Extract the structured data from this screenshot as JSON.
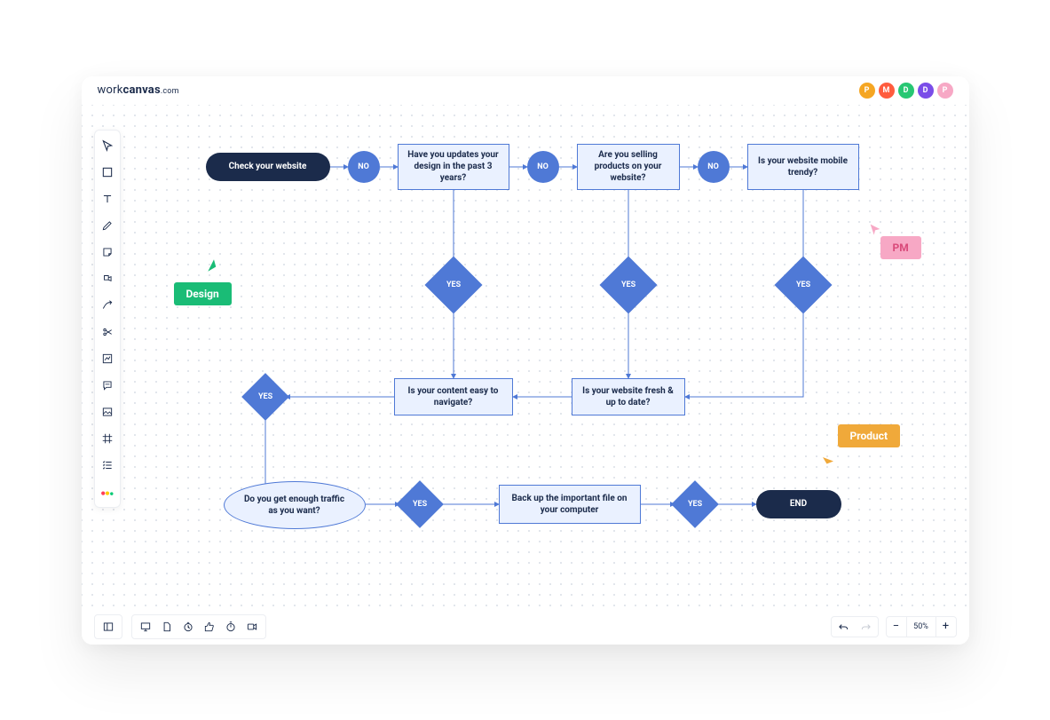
{
  "logo": {
    "part1": "work",
    "part2": "canvas",
    "tld": ".com"
  },
  "avatars": [
    {
      "initial": "P",
      "color": "#f5a623"
    },
    {
      "initial": "M",
      "color": "#ff5c3e"
    },
    {
      "initial": "D",
      "color": "#27c773"
    },
    {
      "initial": "D",
      "color": "#7a4de8"
    },
    {
      "initial": "P",
      "color": "#f7a8c5"
    }
  ],
  "zoom": {
    "level": "50%"
  },
  "nodes": {
    "start": "Check your website",
    "q1": "Have you updates your design in the past 3 years?",
    "q2": "Are you selling products on your website?",
    "q3": "Is your website mobile trendy?",
    "q4": "Is your content easy to navigate?",
    "q5": "Is your website fresh & up to date?",
    "q6": "Do you get enough traffic as you want?",
    "backup": "Back up the important file on your computer",
    "end": "END"
  },
  "labels": {
    "no": "NO",
    "yes": "YES"
  },
  "user_tags": {
    "design": {
      "text": "Design",
      "color": "#1abc76"
    },
    "pm": {
      "text": "PM",
      "color": "#f7a8c5"
    },
    "product": {
      "text": "Product",
      "color": "#f0a93a"
    }
  },
  "chart_data": {
    "type": "flowchart",
    "title": "Website audit decision flow",
    "nodes": [
      {
        "id": "start",
        "type": "terminator",
        "text": "Check your website"
      },
      {
        "id": "no1",
        "type": "connector-circle",
        "text": "NO"
      },
      {
        "id": "q1",
        "type": "process",
        "text": "Have you updates your design in the past 3 years?"
      },
      {
        "id": "no2",
        "type": "connector-circle",
        "text": "NO"
      },
      {
        "id": "q2",
        "type": "process",
        "text": "Are you selling products on your website?"
      },
      {
        "id": "no3",
        "type": "connector-circle",
        "text": "NO"
      },
      {
        "id": "q3",
        "type": "process",
        "text": "Is your website mobile trendy?"
      },
      {
        "id": "yes1",
        "type": "decision",
        "text": "YES"
      },
      {
        "id": "yes2",
        "type": "decision",
        "text": "YES"
      },
      {
        "id": "yes3",
        "type": "decision",
        "text": "YES"
      },
      {
        "id": "q4",
        "type": "process",
        "text": "Is your content easy to navigate?"
      },
      {
        "id": "q5",
        "type": "process",
        "text": "Is your website fresh & up to date?"
      },
      {
        "id": "yes4",
        "type": "decision",
        "text": "YES"
      },
      {
        "id": "q6",
        "type": "ellipse",
        "text": "Do you get enough traffic as you want?"
      },
      {
        "id": "yes5",
        "type": "decision",
        "text": "YES"
      },
      {
        "id": "backup",
        "type": "process",
        "text": "Back up the important file on your computer"
      },
      {
        "id": "yes6",
        "type": "decision",
        "text": "YES"
      },
      {
        "id": "end",
        "type": "terminator",
        "text": "END"
      }
    ],
    "edges": [
      {
        "from": "start",
        "to": "no1"
      },
      {
        "from": "no1",
        "to": "q1"
      },
      {
        "from": "q1",
        "to": "no2"
      },
      {
        "from": "no2",
        "to": "q2"
      },
      {
        "from": "q2",
        "to": "no3"
      },
      {
        "from": "no3",
        "to": "q3"
      },
      {
        "from": "q1",
        "to": "yes1"
      },
      {
        "from": "q2",
        "to": "yes2"
      },
      {
        "from": "q3",
        "to": "yes3"
      },
      {
        "from": "yes1",
        "to": "q4"
      },
      {
        "from": "yes2",
        "to": "q5"
      },
      {
        "from": "yes3",
        "to": "q5"
      },
      {
        "from": "q5",
        "to": "q4"
      },
      {
        "from": "q4",
        "to": "yes4"
      },
      {
        "from": "yes4",
        "to": "q6"
      },
      {
        "from": "q6",
        "to": "yes5"
      },
      {
        "from": "yes5",
        "to": "backup"
      },
      {
        "from": "backup",
        "to": "yes6"
      },
      {
        "from": "yes6",
        "to": "end"
      }
    ]
  }
}
